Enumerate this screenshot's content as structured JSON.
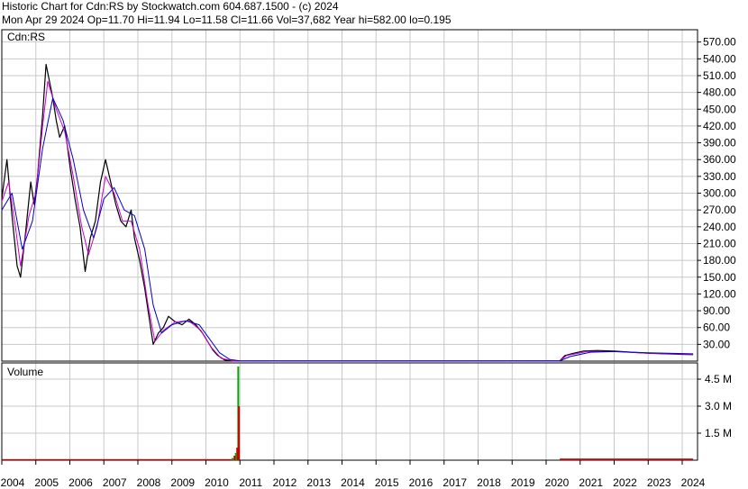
{
  "header": {
    "line1": "Historic Chart for Cdn:RS by Stockwatch.com 604.687.1500 - (c) 2024",
    "line2": "Mon Apr 29 2024   Op=11.70   Hi=11.94   Lo=11.58   Cl=11.66   Vol=37,682   Year hi=582.00   lo=0.195"
  },
  "chart_data": {
    "type": "line",
    "symbol_label": "Cdn:RS",
    "volume_label": "Volume",
    "x_tick_labels": [
      "2004",
      "2005",
      "2006",
      "2007",
      "2008",
      "2009",
      "2010",
      "2011",
      "2012",
      "2013",
      "2014",
      "2015",
      "2016",
      "2017",
      "2018",
      "2019",
      "2020",
      "2021",
      "2022",
      "2023",
      "2024"
    ],
    "price": {
      "ylim": [
        0,
        592
      ],
      "y_ticks": [
        30,
        60,
        90,
        120,
        150,
        180,
        210,
        240,
        270,
        300,
        330,
        360,
        390,
        420,
        450,
        480,
        510,
        540,
        570
      ],
      "y_tick_labels": [
        "30.00",
        "60.00",
        "90.00",
        "120.00",
        "150.00",
        "180.00",
        "210.00",
        "240.00",
        "270.00",
        "300.00",
        "330.00",
        "360.00",
        "390.00",
        "420.00",
        "450.00",
        "480.00",
        "510.00",
        "540.00",
        "570.00"
      ],
      "series": [
        {
          "color": "#000000",
          "points": [
            [
              2004.0,
              290
            ],
            [
              2004.15,
              360
            ],
            [
              2004.3,
              260
            ],
            [
              2004.45,
              170
            ],
            [
              2004.55,
              150
            ],
            [
              2004.7,
              230
            ],
            [
              2004.85,
              320
            ],
            [
              2004.95,
              280
            ],
            [
              2005.05,
              330
            ],
            [
              2005.2,
              440
            ],
            [
              2005.3,
              530
            ],
            [
              2005.4,
              500
            ],
            [
              2005.5,
              470
            ],
            [
              2005.6,
              430
            ],
            [
              2005.7,
              400
            ],
            [
              2005.85,
              420
            ],
            [
              2006.0,
              350
            ],
            [
              2006.15,
              290
            ],
            [
              2006.3,
              240
            ],
            [
              2006.45,
              160
            ],
            [
              2006.6,
              220
            ],
            [
              2006.75,
              250
            ],
            [
              2006.9,
              320
            ],
            [
              2007.05,
              360
            ],
            [
              2007.2,
              320
            ],
            [
              2007.35,
              280
            ],
            [
              2007.5,
              250
            ],
            [
              2007.65,
              240
            ],
            [
              2007.8,
              270
            ],
            [
              2007.9,
              220
            ],
            [
              2008.05,
              180
            ],
            [
              2008.2,
              130
            ],
            [
              2008.35,
              70
            ],
            [
              2008.45,
              30
            ],
            [
              2008.6,
              50
            ],
            [
              2008.75,
              60
            ],
            [
              2008.9,
              80
            ],
            [
              2009.1,
              70
            ],
            [
              2009.3,
              65
            ],
            [
              2009.5,
              75
            ],
            [
              2009.7,
              65
            ],
            [
              2009.9,
              50
            ],
            [
              2010.05,
              35
            ],
            [
              2010.2,
              20
            ],
            [
              2010.35,
              10
            ],
            [
              2010.55,
              2
            ],
            [
              2010.8,
              0.3
            ],
            [
              2011.5,
              0.2
            ],
            [
              2015.0,
              0.2
            ],
            [
              2019.0,
              0.2
            ],
            [
              2020.4,
              0.3
            ],
            [
              2020.55,
              10
            ],
            [
              2020.8,
              14
            ],
            [
              2021.1,
              18
            ],
            [
              2021.5,
              19
            ],
            [
              2022.0,
              18
            ],
            [
              2022.5,
              16
            ],
            [
              2023.0,
              14
            ],
            [
              2023.5,
              13
            ],
            [
              2024.0,
              12
            ],
            [
              2024.32,
              11.66
            ]
          ]
        },
        {
          "color": "#cc00cc",
          "points": [
            [
              2004.0,
              285
            ],
            [
              2004.2,
              320
            ],
            [
              2004.4,
              240
            ],
            [
              2004.55,
              170
            ],
            [
              2004.8,
              260
            ],
            [
              2005.0,
              300
            ],
            [
              2005.2,
              420
            ],
            [
              2005.35,
              500
            ],
            [
              2005.6,
              450
            ],
            [
              2005.85,
              410
            ],
            [
              2006.1,
              330
            ],
            [
              2006.35,
              240
            ],
            [
              2006.55,
              190
            ],
            [
              2006.8,
              240
            ],
            [
              2007.05,
              330
            ],
            [
              2007.3,
              300
            ],
            [
              2007.55,
              250
            ],
            [
              2007.8,
              250
            ],
            [
              2008.05,
              200
            ],
            [
              2008.3,
              100
            ],
            [
              2008.5,
              35
            ],
            [
              2008.75,
              55
            ],
            [
              2009.1,
              70
            ],
            [
              2009.5,
              72
            ],
            [
              2009.85,
              55
            ],
            [
              2010.15,
              25
            ],
            [
              2010.45,
              5
            ],
            [
              2010.8,
              0.5
            ],
            [
              2011.5,
              0.2
            ],
            [
              2020.4,
              0.3
            ],
            [
              2020.6,
              10
            ],
            [
              2021.2,
              17
            ],
            [
              2022.0,
              17
            ],
            [
              2023.0,
              14
            ],
            [
              2024.32,
              12
            ]
          ]
        },
        {
          "color": "#0000cc",
          "points": [
            [
              2004.0,
              270
            ],
            [
              2004.3,
              300
            ],
            [
              2004.6,
              200
            ],
            [
              2004.9,
              250
            ],
            [
              2005.2,
              380
            ],
            [
              2005.5,
              470
            ],
            [
              2005.8,
              430
            ],
            [
              2006.1,
              360
            ],
            [
              2006.4,
              270
            ],
            [
              2006.7,
              220
            ],
            [
              2007.0,
              290
            ],
            [
              2007.3,
              310
            ],
            [
              2007.6,
              270
            ],
            [
              2007.9,
              260
            ],
            [
              2008.2,
              200
            ],
            [
              2008.45,
              100
            ],
            [
              2008.7,
              50
            ],
            [
              2009.0,
              65
            ],
            [
              2009.4,
              72
            ],
            [
              2009.8,
              65
            ],
            [
              2010.1,
              40
            ],
            [
              2010.4,
              15
            ],
            [
              2010.7,
              3
            ],
            [
              2011.0,
              0.5
            ],
            [
              2011.5,
              0.2
            ],
            [
              2020.4,
              0.3
            ],
            [
              2020.7,
              8
            ],
            [
              2021.3,
              16
            ],
            [
              2022.0,
              17
            ],
            [
              2023.0,
              15
            ],
            [
              2024.32,
              13
            ]
          ]
        }
      ]
    },
    "volume": {
      "ylim": [
        0,
        5400000
      ],
      "y_ticks": [
        1500000,
        3000000,
        4500000
      ],
      "y_tick_labels": [
        "1.5 M",
        "3.0 M",
        "4.5 M"
      ],
      "bars": [
        {
          "x": 2010.95,
          "value": 5200000,
          "color": "#00aa00"
        },
        {
          "x": 2010.97,
          "value": 3000000,
          "color": "#cc0000"
        },
        {
          "x": 2010.92,
          "value": 700000,
          "color": "#cc0000"
        },
        {
          "x": 2010.88,
          "value": 400000,
          "color": "#00aa00"
        },
        {
          "x": 2010.84,
          "value": 250000,
          "color": "#cc0000"
        },
        {
          "x": 2010.78,
          "value": 120000,
          "color": "#00aa00"
        }
      ],
      "baseline": [
        {
          "from": 2004.0,
          "to": 2010.75,
          "value": 60000,
          "color": "#cc0000"
        },
        {
          "from": 2020.4,
          "to": 2024.32,
          "value": 90000,
          "color": "#cc0000"
        }
      ]
    },
    "grid": true
  }
}
